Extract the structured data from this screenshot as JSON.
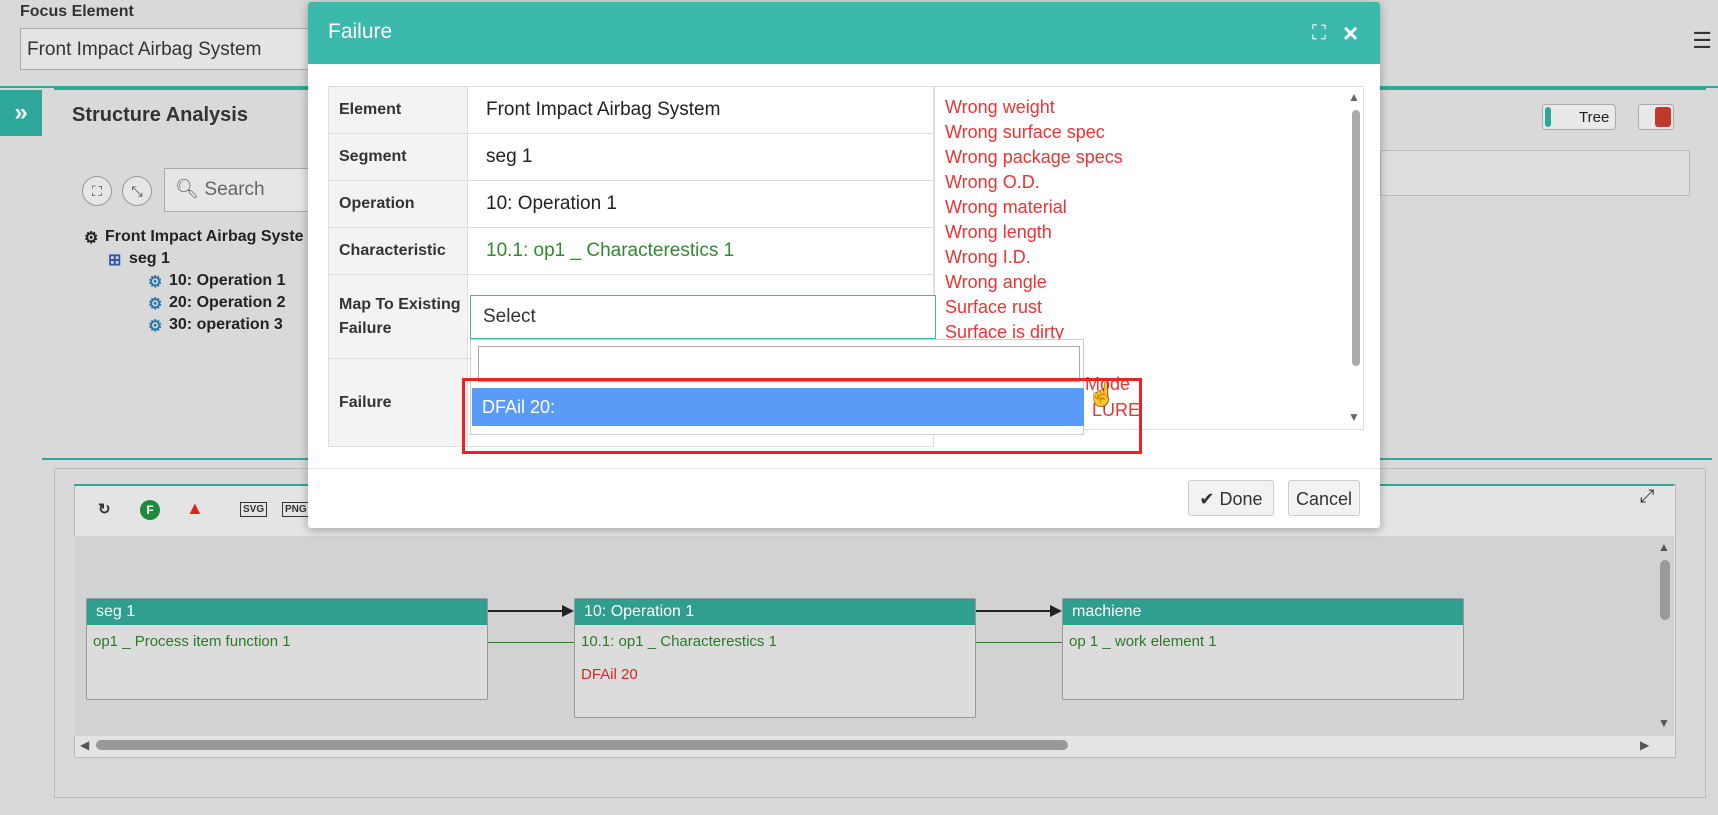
{
  "colors": {
    "teal": "#3bb9aa",
    "teal_dark": "#2f9e8f",
    "red_text": "#e33333",
    "green_text": "#2e8b2e",
    "option_blue": "#5b9bf8"
  },
  "focus": {
    "label": "Focus Element",
    "value": "Front Impact Airbag System"
  },
  "sidebar_toggle": "»",
  "structure": {
    "title": "Structure Analysis",
    "tree_label": "Tree",
    "search_placeholder": "Search",
    "tree": [
      {
        "label": "Front Impact Airbag Syste",
        "icon": "gears-icon"
      },
      {
        "label": "seg 1",
        "icon": "segment-icon"
      },
      {
        "label": "10: Operation 1",
        "icon": "operation-icon"
      },
      {
        "label": "20: Operation 2",
        "icon": "operation-icon"
      },
      {
        "label": "30: operation 3",
        "icon": "operation-icon"
      }
    ]
  },
  "toolbar": {
    "refresh": "↻",
    "f_badge": "F",
    "warn_badge": "F",
    "svg": "SVG",
    "png": "PNG",
    "expand": "⤢"
  },
  "diagram": {
    "nodes": [
      {
        "title": "seg 1",
        "line1": "op1 _ Process item function 1",
        "line2": ""
      },
      {
        "title": "10: Operation 1",
        "line1": "10.1: op1 _ Characterestics 1",
        "line2": "DFAil 20"
      },
      {
        "title": "machiene",
        "line1": "op 1 _ work element 1",
        "line2": ""
      }
    ]
  },
  "modal": {
    "title": "Failure",
    "fields": {
      "element_label": "Element",
      "element_value": "Front Impact Airbag System",
      "segment_label": "Segment",
      "segment_value": "seg 1",
      "operation_label": "Operation",
      "operation_value": "10: Operation 1",
      "characteristic_label": "Characteristic",
      "characteristic_value": "10.1: op1 _ Characterestics 1",
      "map_label": "Map To Existing Failure",
      "failure_label": "Failure"
    },
    "select_value": "Select",
    "dropdown_option": "DFAil 20:",
    "failure_list": [
      "Wrong weight",
      "Wrong surface spec",
      "Wrong package specs",
      "Wrong O.D.",
      "Wrong material",
      "Wrong length",
      "Wrong I.D.",
      "Wrong angle",
      "Surface rust",
      "Surface is dirty"
    ],
    "hidden_item_tail_1": "Mode",
    "hidden_item_tail_2": "LURE",
    "done_label": "Done",
    "cancel_label": "Cancel"
  }
}
